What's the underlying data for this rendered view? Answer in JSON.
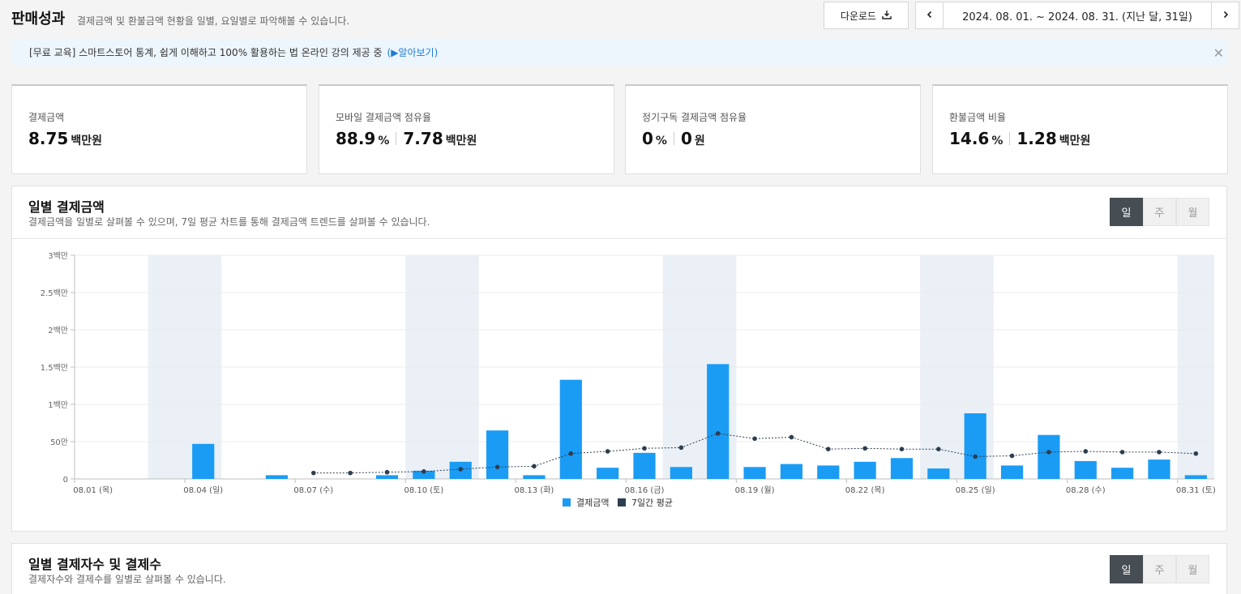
{
  "header": {
    "title": "판매성과",
    "description": "결제금액 및 환불금액 현황을 일별, 요일별로 파악해볼 수 있습니다.",
    "download_label": "다운로드",
    "date_range": "2024. 08. 01. ~ 2024. 08. 31. (지난 달, 31일)"
  },
  "notice": {
    "text": "[무료 교육] 스마트스토어 통계, 쉽게 이해하고 100% 활용하는 법 온라인 강의 제공 중",
    "link": "(▶알아보기)"
  },
  "stats": [
    {
      "label": "결제금액",
      "parts": [
        {
          "num": "8.75",
          "unit": "백만원"
        }
      ]
    },
    {
      "label": "모바일 결제금액 점유율",
      "parts": [
        {
          "num": "88.9",
          "unit": "%"
        },
        {
          "num": "7.78",
          "unit": "백만원"
        }
      ]
    },
    {
      "label": "정기구독 결제금액 점유율",
      "parts": [
        {
          "num": "0",
          "unit": "%"
        },
        {
          "num": "0",
          "unit": "원"
        }
      ]
    },
    {
      "label": "환불금액 비율",
      "parts": [
        {
          "num": "14.6",
          "unit": "%"
        },
        {
          "num": "1.28",
          "unit": "백만원"
        }
      ]
    }
  ],
  "section1": {
    "title": "일별 결제금액",
    "subtitle": "결제금액을 일별로 살펴볼 수 있으며, 7일 평균 차트를 통해 결제금액 트렌드를 살펴볼 수 있습니다.",
    "toggle": [
      "일",
      "주",
      "월"
    ]
  },
  "section2": {
    "title": "일별 결제자수 및 결제수",
    "subtitle": "결제자수와 결제수를 일별로 살펴볼 수 있습니다.",
    "toggle": [
      "일",
      "주",
      "월"
    ]
  },
  "colors": {
    "bar": "#1a9cf5",
    "line": "#2c3e50",
    "weekend_band": "#eaf0f6",
    "toggle_active": "#464d53",
    "link": "#1a7cd9"
  },
  "chart_data": {
    "type": "bar",
    "y_ticks": [
      "0",
      "50만",
      "1백만",
      "1.5백만",
      "2백만",
      "2.5백만",
      "3백만"
    ],
    "ylim": [
      0,
      3000000
    ],
    "x_labels": [
      {
        "day": 1,
        "label": "08.01 (목)"
      },
      {
        "day": 4,
        "label": "08.04 (일)"
      },
      {
        "day": 7,
        "label": "08.07 (수)"
      },
      {
        "day": 10,
        "label": "08.10 (토)"
      },
      {
        "day": 13,
        "label": "08.13 (화)"
      },
      {
        "day": 16,
        "label": "08.16 (금)"
      },
      {
        "day": 19,
        "label": "08.19 (월)"
      },
      {
        "day": 22,
        "label": "08.22 (목)"
      },
      {
        "day": 25,
        "label": "08.25 (일)"
      },
      {
        "day": 28,
        "label": "08.28 (수)"
      },
      {
        "day": 31,
        "label": "08.31 (토)"
      }
    ],
    "weekend_days": [
      [
        3,
        4
      ],
      [
        10,
        11
      ],
      [
        17,
        18
      ],
      [
        24,
        25
      ],
      [
        31
      ]
    ],
    "legend": [
      "결제금액",
      "7일간 평균"
    ],
    "series": [
      {
        "name": "결제금액",
        "type": "bar",
        "values": [
          0,
          0,
          0,
          470000,
          0,
          50000,
          0,
          0,
          50000,
          110000,
          230000,
          650000,
          50000,
          1330000,
          150000,
          350000,
          160000,
          1540000,
          160000,
          200000,
          180000,
          230000,
          280000,
          140000,
          880000,
          180000,
          590000,
          240000,
          150000,
          260000,
          50000
        ]
      },
      {
        "name": "7일간 평균",
        "type": "line",
        "values": [
          null,
          null,
          null,
          null,
          null,
          null,
          80000,
          80000,
          90000,
          100000,
          130000,
          160000,
          170000,
          340000,
          370000,
          410000,
          420000,
          610000,
          540000,
          560000,
          400000,
          410000,
          400000,
          400000,
          300000,
          310000,
          360000,
          370000,
          360000,
          360000,
          340000
        ]
      }
    ]
  }
}
